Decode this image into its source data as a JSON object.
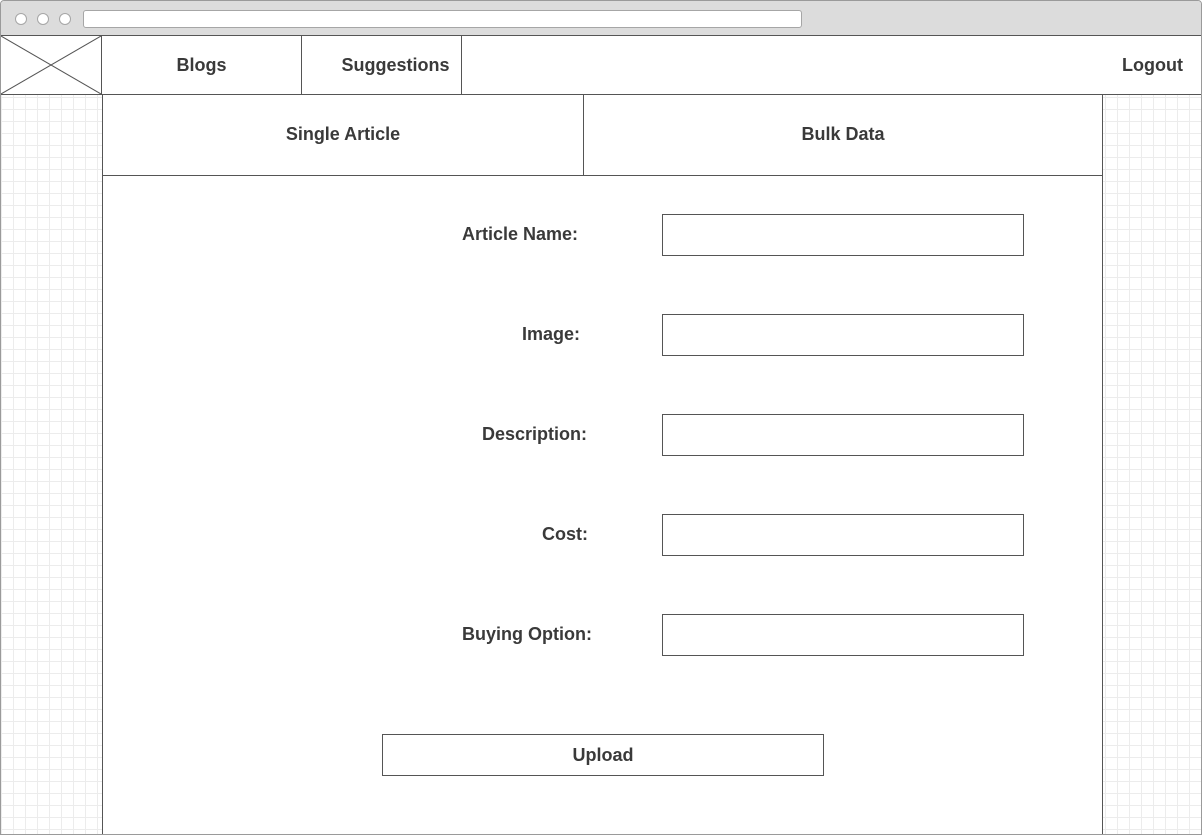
{
  "nav": {
    "items": [
      {
        "label": "Blogs"
      },
      {
        "label": "Suggestions"
      }
    ],
    "logout_label": "Logout"
  },
  "tabs": [
    {
      "label": "Single Article"
    },
    {
      "label": "Bulk Data"
    }
  ],
  "form": {
    "fields": [
      {
        "label": "Article Name:",
        "value": ""
      },
      {
        "label": "Image:",
        "value": ""
      },
      {
        "label": "Description:",
        "value": ""
      },
      {
        "label": "Cost:",
        "value": ""
      },
      {
        "label": "Buying Option:",
        "value": ""
      }
    ],
    "submit_label": "Upload"
  }
}
